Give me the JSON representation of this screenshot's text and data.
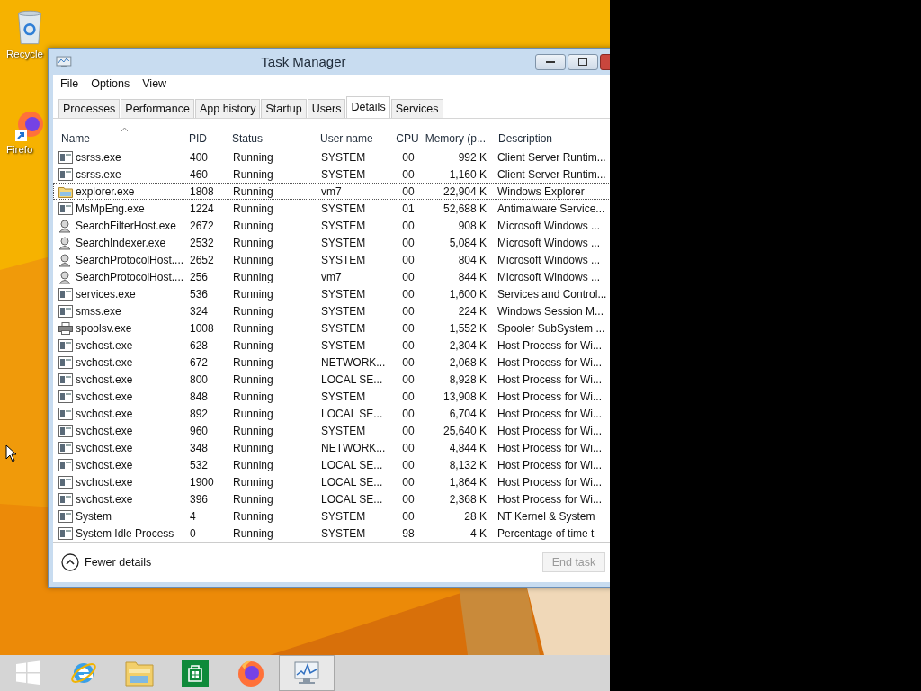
{
  "desktop": {
    "icons": [
      {
        "kind": "recycle-bin",
        "label": "Recycle"
      },
      {
        "kind": "firefox",
        "label": "Firefo"
      }
    ]
  },
  "window": {
    "title": "Task Manager"
  },
  "menu": [
    "File",
    "Options",
    "View"
  ],
  "tabs": [
    {
      "label": "Processes",
      "selected": false
    },
    {
      "label": "Performance",
      "selected": false
    },
    {
      "label": "App history",
      "selected": false
    },
    {
      "label": "Startup",
      "selected": false
    },
    {
      "label": "Users",
      "selected": false
    },
    {
      "label": "Details",
      "selected": true
    },
    {
      "label": "Services",
      "selected": false
    }
  ],
  "table": {
    "columns": [
      {
        "label": "Name",
        "sorted": true
      },
      {
        "label": "PID",
        "sorted": false
      },
      {
        "label": "Status",
        "sorted": false
      },
      {
        "label": "User name",
        "sorted": false
      },
      {
        "label": "CPU",
        "sorted": false
      },
      {
        "label": "Memory (p...",
        "sorted": false
      },
      {
        "label": "Description",
        "sorted": false
      }
    ],
    "rows": [
      {
        "kind": "app",
        "name": "csrss.exe",
        "pid": "400",
        "status": "Running",
        "user": "SYSTEM",
        "cpu": "00",
        "memory": "992 K",
        "description": "Client Server Runtim...",
        "selected": false
      },
      {
        "kind": "app",
        "name": "csrss.exe",
        "pid": "460",
        "status": "Running",
        "user": "SYSTEM",
        "cpu": "00",
        "memory": "1,160 K",
        "description": "Client Server Runtim...",
        "selected": false
      },
      {
        "kind": "explorer",
        "name": "explorer.exe",
        "pid": "1808",
        "status": "Running",
        "user": "vm7",
        "cpu": "00",
        "memory": "22,904 K",
        "description": "Windows Explorer",
        "selected": true
      },
      {
        "kind": "app",
        "name": "MsMpEng.exe",
        "pid": "1224",
        "status": "Running",
        "user": "SYSTEM",
        "cpu": "01",
        "memory": "52,688 K",
        "description": "Antimalware Service...",
        "selected": false
      },
      {
        "kind": "search",
        "name": "SearchFilterHost.exe",
        "pid": "2672",
        "status": "Running",
        "user": "SYSTEM",
        "cpu": "00",
        "memory": "908 K",
        "description": "Microsoft Windows ...",
        "selected": false
      },
      {
        "kind": "search",
        "name": "SearchIndexer.exe",
        "pid": "2532",
        "status": "Running",
        "user": "SYSTEM",
        "cpu": "00",
        "memory": "5,084 K",
        "description": "Microsoft Windows ...",
        "selected": false
      },
      {
        "kind": "search",
        "name": "SearchProtocolHost....",
        "pid": "2652",
        "status": "Running",
        "user": "SYSTEM",
        "cpu": "00",
        "memory": "804 K",
        "description": "Microsoft Windows ...",
        "selected": false
      },
      {
        "kind": "search",
        "name": "SearchProtocolHost....",
        "pid": "256",
        "status": "Running",
        "user": "vm7",
        "cpu": "00",
        "memory": "844 K",
        "description": "Microsoft Windows ...",
        "selected": false
      },
      {
        "kind": "app",
        "name": "services.exe",
        "pid": "536",
        "status": "Running",
        "user": "SYSTEM",
        "cpu": "00",
        "memory": "1,600 K",
        "description": "Services and Control...",
        "selected": false
      },
      {
        "kind": "app",
        "name": "smss.exe",
        "pid": "324",
        "status": "Running",
        "user": "SYSTEM",
        "cpu": "00",
        "memory": "224 K",
        "description": "Windows Session M...",
        "selected": false
      },
      {
        "kind": "printer",
        "name": "spoolsv.exe",
        "pid": "1008",
        "status": "Running",
        "user": "SYSTEM",
        "cpu": "00",
        "memory": "1,552 K",
        "description": "Spooler SubSystem ...",
        "selected": false
      },
      {
        "kind": "app",
        "name": "svchost.exe",
        "pid": "628",
        "status": "Running",
        "user": "SYSTEM",
        "cpu": "00",
        "memory": "2,304 K",
        "description": "Host Process for Wi...",
        "selected": false
      },
      {
        "kind": "app",
        "name": "svchost.exe",
        "pid": "672",
        "status": "Running",
        "user": "NETWORK...",
        "cpu": "00",
        "memory": "2,068 K",
        "description": "Host Process for Wi...",
        "selected": false
      },
      {
        "kind": "app",
        "name": "svchost.exe",
        "pid": "800",
        "status": "Running",
        "user": "LOCAL SE...",
        "cpu": "00",
        "memory": "8,928 K",
        "description": "Host Process for Wi...",
        "selected": false
      },
      {
        "kind": "app",
        "name": "svchost.exe",
        "pid": "848",
        "status": "Running",
        "user": "SYSTEM",
        "cpu": "00",
        "memory": "13,908 K",
        "description": "Host Process for Wi...",
        "selected": false
      },
      {
        "kind": "app",
        "name": "svchost.exe",
        "pid": "892",
        "status": "Running",
        "user": "LOCAL SE...",
        "cpu": "00",
        "memory": "6,704 K",
        "description": "Host Process for Wi...",
        "selected": false
      },
      {
        "kind": "app",
        "name": "svchost.exe",
        "pid": "960",
        "status": "Running",
        "user": "SYSTEM",
        "cpu": "00",
        "memory": "25,640 K",
        "description": "Host Process for Wi...",
        "selected": false
      },
      {
        "kind": "app",
        "name": "svchost.exe",
        "pid": "348",
        "status": "Running",
        "user": "NETWORK...",
        "cpu": "00",
        "memory": "4,844 K",
        "description": "Host Process for Wi...",
        "selected": false
      },
      {
        "kind": "app",
        "name": "svchost.exe",
        "pid": "532",
        "status": "Running",
        "user": "LOCAL SE...",
        "cpu": "00",
        "memory": "8,132 K",
        "description": "Host Process for Wi...",
        "selected": false
      },
      {
        "kind": "app",
        "name": "svchost.exe",
        "pid": "1900",
        "status": "Running",
        "user": "LOCAL SE...",
        "cpu": "00",
        "memory": "1,864 K",
        "description": "Host Process for Wi...",
        "selected": false
      },
      {
        "kind": "app",
        "name": "svchost.exe",
        "pid": "396",
        "status": "Running",
        "user": "LOCAL SE...",
        "cpu": "00",
        "memory": "2,368 K",
        "description": "Host Process for Wi...",
        "selected": false
      },
      {
        "kind": "app",
        "name": "System",
        "pid": "4",
        "status": "Running",
        "user": "SYSTEM",
        "cpu": "00",
        "memory": "28 K",
        "description": "NT Kernel & System",
        "selected": false
      },
      {
        "kind": "app",
        "name": "System Idle Process",
        "pid": "0",
        "status": "Running",
        "user": "SYSTEM",
        "cpu": "98",
        "memory": "4 K",
        "description": "Percentage of time t",
        "selected": false
      }
    ]
  },
  "footer": {
    "details_toggle": "Fewer details",
    "end_task": {
      "label": "End task",
      "disabled": true
    }
  },
  "taskbar": [
    {
      "kind": "start",
      "selected": false
    },
    {
      "kind": "browser",
      "selected": false
    },
    {
      "kind": "folder",
      "selected": false
    },
    {
      "kind": "store",
      "selected": false
    },
    {
      "kind": "firefox",
      "selected": false
    },
    {
      "kind": "task-manager",
      "selected": true
    }
  ]
}
